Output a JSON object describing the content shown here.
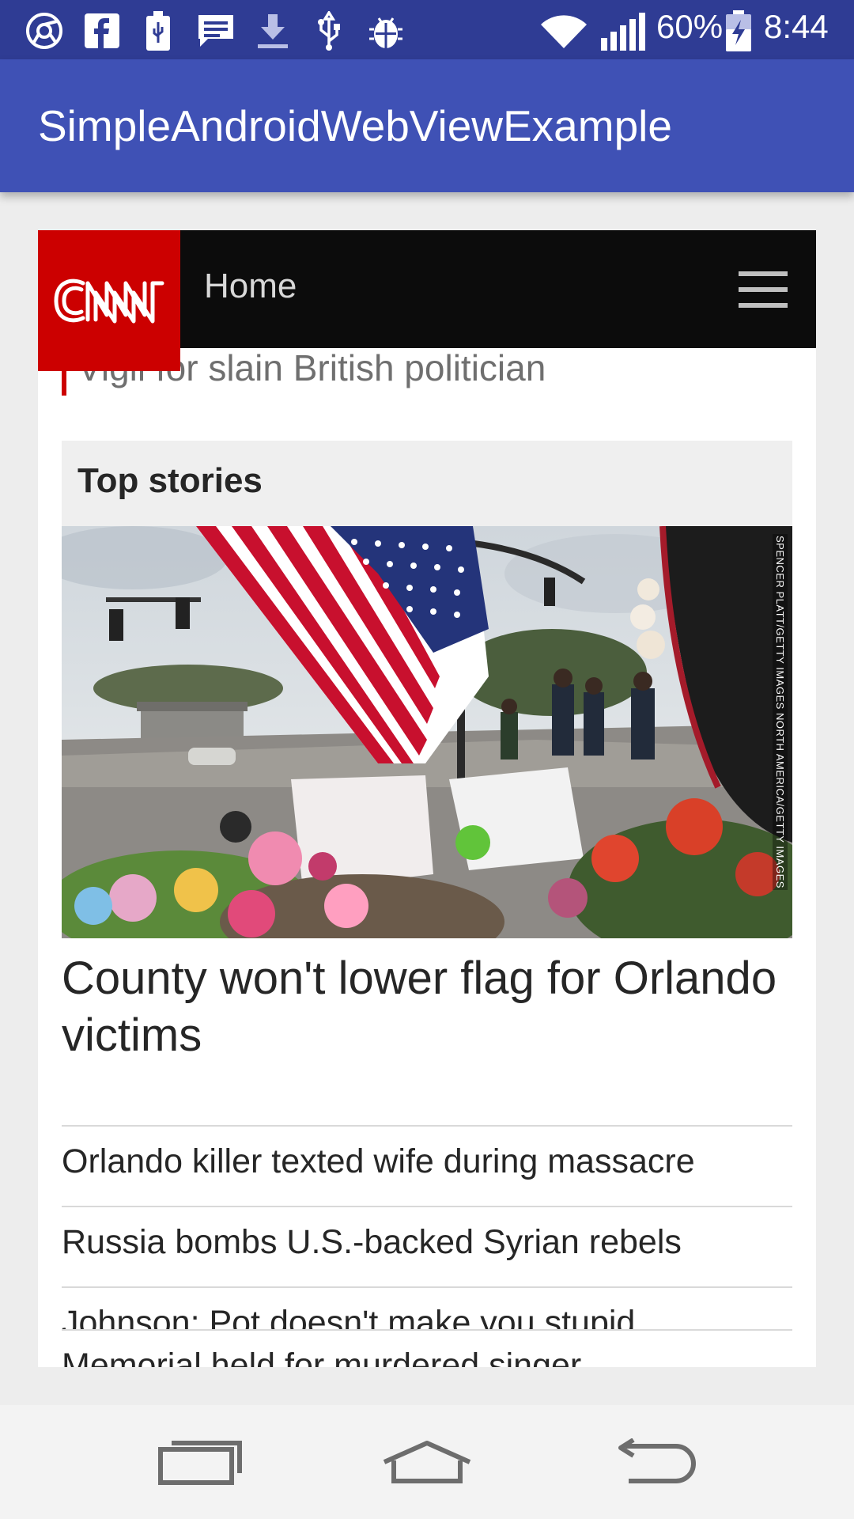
{
  "status_bar": {
    "battery_percent": "60%",
    "time": "8:44",
    "left_icons": [
      "chrome-icon",
      "facebook-icon",
      "usb-battery-icon",
      "message-icon",
      "download-icon",
      "usb-icon",
      "bug-icon"
    ],
    "right_icons": [
      "wifi-icon",
      "signal-icon",
      "battery-charging-icon"
    ]
  },
  "app_bar": {
    "title": "SimpleAndroidWebViewExample"
  },
  "cnn": {
    "logo_text": "CNN",
    "nav_label": "Home",
    "breaking_text": "Vigil for slain British politician",
    "section_title": "Top stories",
    "hero_credit": "SPENCER PLATT/GETTY IMAGES NORTH AMERICA/GETTY IMAGES",
    "headline": "County won't lower flag for Orlando victims",
    "stories": [
      "Orlando killer texted wife during massacre",
      "Russia bombs U.S.-backed Syrian rebels",
      "Johnson: Pot doesn't make you stupid",
      "Memorial held for murdered singer"
    ]
  },
  "colors": {
    "status_bar": "#2f3c94",
    "app_bar": "#3f51b5",
    "cnn_red": "#cc0000",
    "cnn_header": "#0c0c0c"
  },
  "nav_bar": {
    "icons": [
      "recent-apps-icon",
      "home-icon",
      "back-icon"
    ]
  }
}
